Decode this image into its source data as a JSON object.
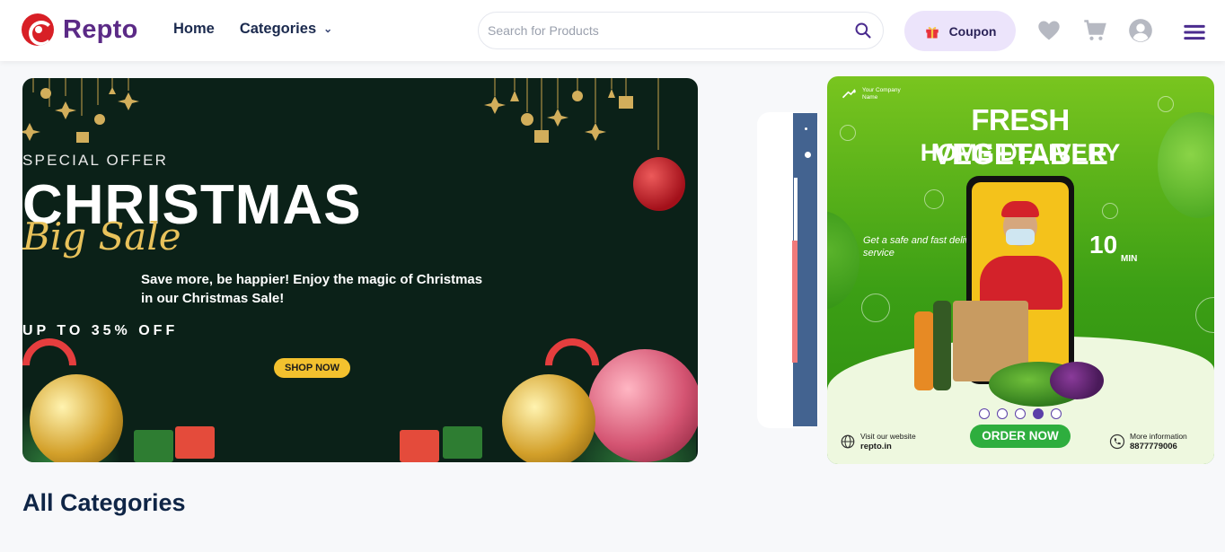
{
  "header": {
    "logo_text": "Repto",
    "nav": {
      "home": "Home",
      "categories": "Categories"
    },
    "search": {
      "placeholder": "Search for Products",
      "value": ""
    },
    "coupon_label": "Coupon",
    "icons": [
      "wishlist-heart-icon",
      "cart-icon",
      "user-account-icon",
      "hamburger-menu-icon"
    ]
  },
  "christmas_banner": {
    "special_offer": "SPECIAL OFFER",
    "headline": "CHRISTMAS",
    "subheadline": "Big Sale",
    "description": "Save more, be happier! Enjoy the magic of Christmas in our Christmas Sale!",
    "discount": "UP TO 35% OFF",
    "cta": "SHOP NOW"
  },
  "vegetable_banner": {
    "company": "Your Company Name",
    "title_line1": "FRESH VEGETABLE",
    "title_line2": "HOME DELIVERY",
    "tagline": "Get a safe and fast delivery service",
    "delivery_time": "10",
    "delivery_unit": "MIN",
    "cta": "ORDER NOW",
    "visit_label": "Visit our website",
    "website": "repto.in",
    "info_label": "More information",
    "phone": "8877779006"
  },
  "carousel": {
    "dot_count": 5,
    "active_index": 3
  },
  "section_title": "All Categories",
  "colors": {
    "brand_purple": "#5b2a86",
    "coupon_bg": "#ece4fb",
    "heading_navy": "#0f2546",
    "dot_active": "#5b3fa8"
  }
}
